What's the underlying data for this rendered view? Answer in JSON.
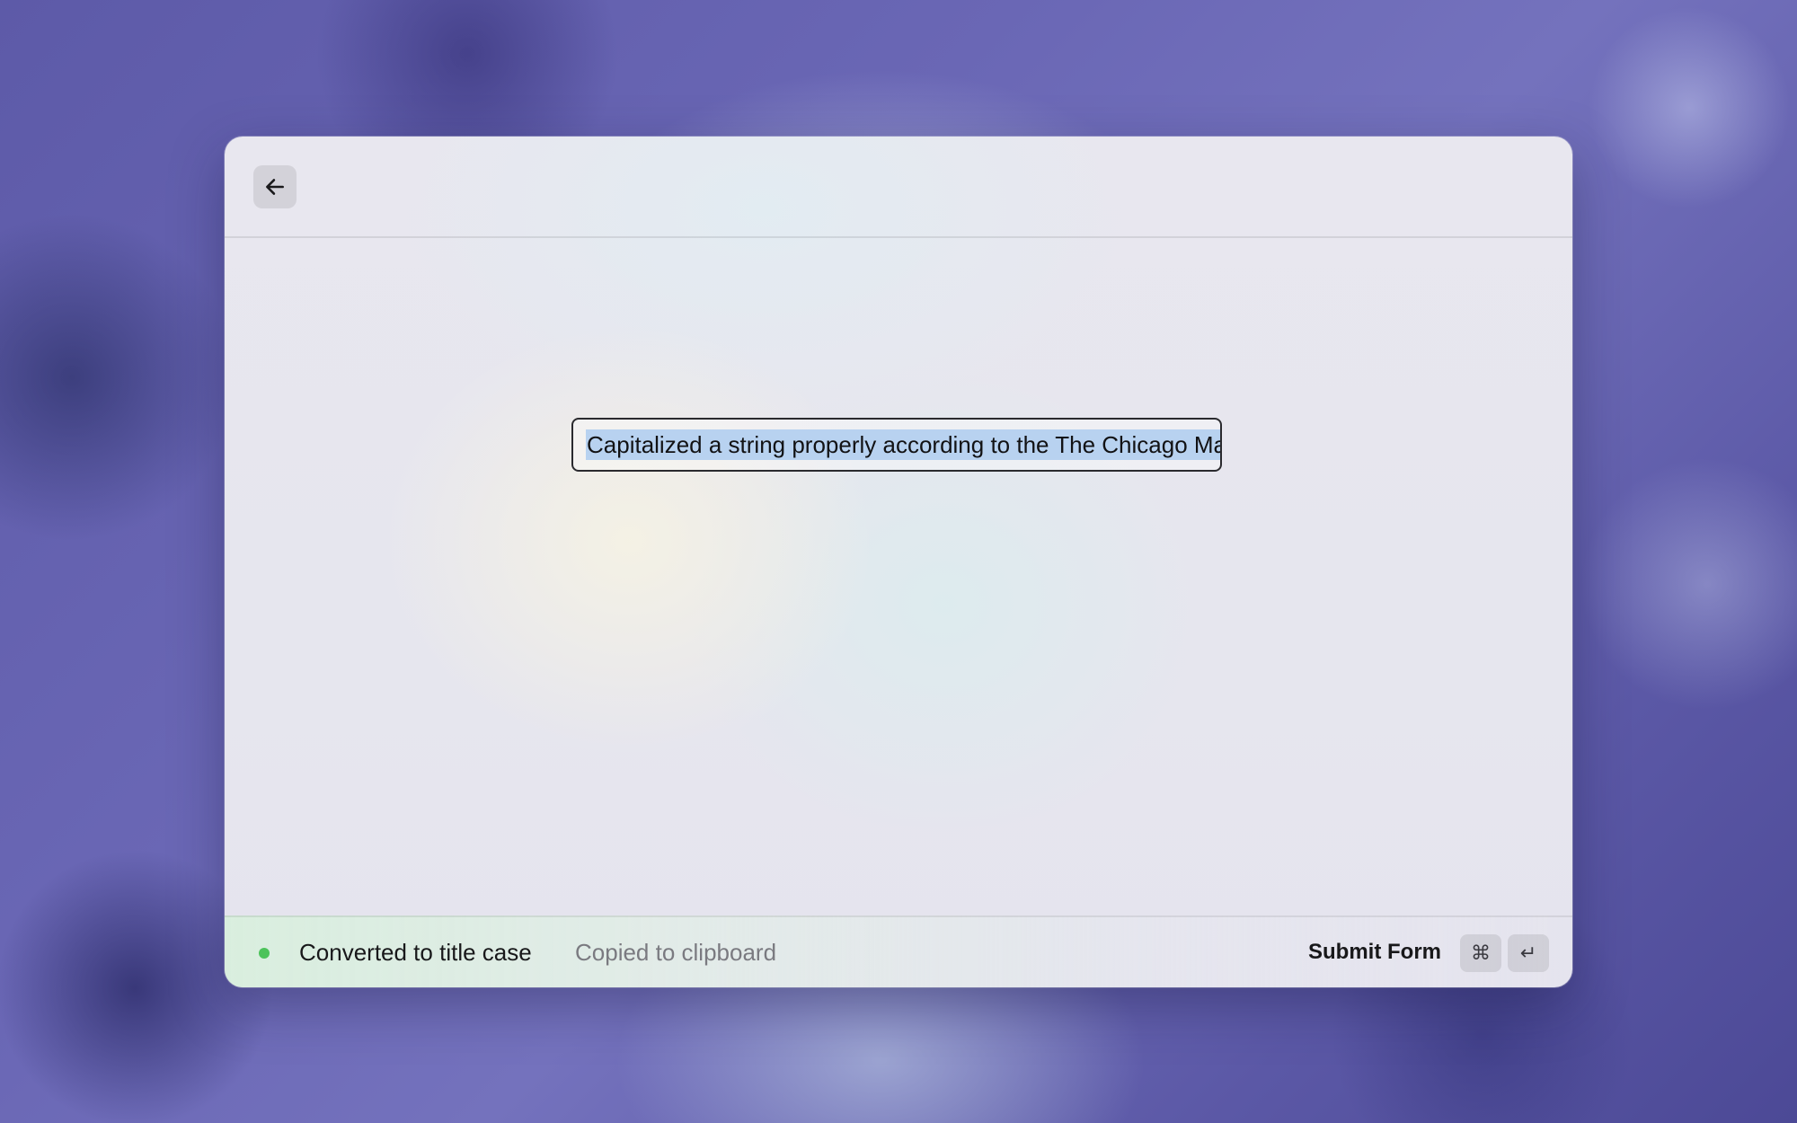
{
  "window": {
    "back_icon": "arrow-left-icon"
  },
  "form": {
    "input_value": "Capitalized a string properly according to the The Chicago Manual of Style"
  },
  "footer": {
    "status_color": "#4cc35a",
    "status_text": "Converted to title case",
    "status_subtext": "Copied to clipboard",
    "submit_label": "Submit Form",
    "shortcut_keys": [
      "⌘",
      "↵"
    ]
  }
}
